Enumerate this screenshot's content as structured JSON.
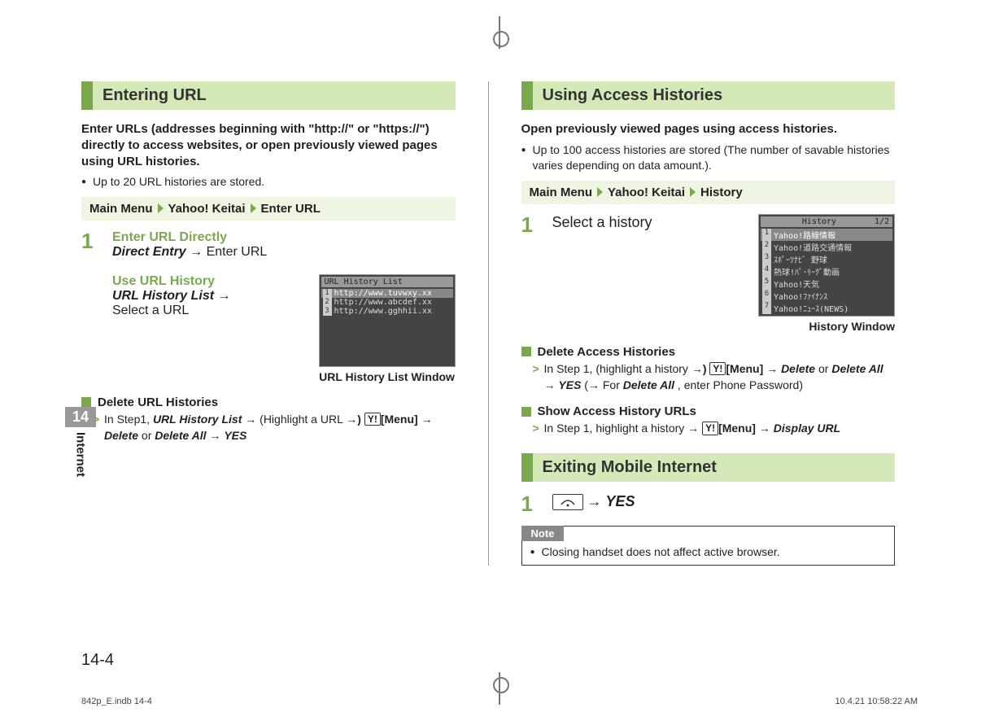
{
  "chapter": {
    "number": "14",
    "label": "Internet"
  },
  "page_number": "14-4",
  "footer": {
    "left": "842p_E.indb   14-4",
    "right": "10.4.21   10:58:22 AM"
  },
  "left": {
    "heading": "Entering URL",
    "intro": "Enter URLs (addresses beginning with \"http://\" or \"https://\") directly to access websites, or open previously viewed pages using URL histories.",
    "note_bullet": "Up to 20 URL histories are stored.",
    "menu": {
      "root": "Main Menu",
      "path1": "Yahoo! Keitai",
      "path2": "Enter URL"
    },
    "step1": {
      "num": "1",
      "sub1_title": "Enter URL Directly",
      "sub1_line_a": "Direct Entry",
      "sub1_line_b": "Enter URL",
      "sub2_title": "Use URL History",
      "sub2_line_a": "URL History List",
      "sub2_line_b": "Select a URL"
    },
    "screenshot": {
      "title": "URL History List",
      "rows": [
        "http://www.tuvwxy.xx",
        "http://www.abcdef.xx",
        "http://www.gghhii.xx"
      ],
      "caption": "URL History List Window"
    },
    "sub_delete": {
      "title": "Delete URL Histories",
      "before": "In Step1, ",
      "url_hist": "URL History List",
      "mid1": "(Highlight a URL",
      "menu_key": "[Menu]",
      "delete": "Delete",
      "or": " or ",
      "delete_all": "Delete All",
      "yes": "YES"
    }
  },
  "right": {
    "heading1": "Using Access Histories",
    "intro1": "Open previously viewed pages using access histories.",
    "bullet1": "Up to 100 access histories are stored (The number of savable histories varies depending on data amount.).",
    "menu": {
      "root": "Main Menu",
      "path1": "Yahoo! Keitai",
      "path2": "History"
    },
    "step1": {
      "num": "1",
      "text": "Select a history"
    },
    "screenshot": {
      "title_left": "",
      "title_center": "History",
      "title_right": "1/2",
      "rows": [
        "Yahoo!路線情報",
        "Yahoo!道路交通情報",
        "ｽﾎﾟｰﾂﾅﾋﾞ 野球",
        "熱球!ﾊﾟ･ﾘｰｸﾞ動画",
        "Yahoo!天気",
        "Yahoo!ﾌｧｲﾅﾝｽ",
        "Yahoo!ﾆｭｰｽ(NEWS)"
      ],
      "caption": "History Window"
    },
    "sub_delete": {
      "title": "Delete Access Histories",
      "before": "In Step 1, (highlight a history",
      "menu_key": "[Menu]",
      "delete": "Delete",
      "or": " or ",
      "delete_all": "Delete All",
      "yes": "YES",
      "tail_a": "For ",
      "tail_b": "Delete All",
      "tail_c": ", enter Phone Password)"
    },
    "sub_show": {
      "title": "Show Access History URLs",
      "before": "In Step 1, highlight a history",
      "menu_key": "[Menu]",
      "display": "Display URL"
    },
    "heading2": "Exiting Mobile Internet",
    "step_exit": {
      "num": "1",
      "yes": "YES"
    },
    "note": {
      "label": "Note",
      "text": "Closing handset does not affect active browser."
    }
  }
}
